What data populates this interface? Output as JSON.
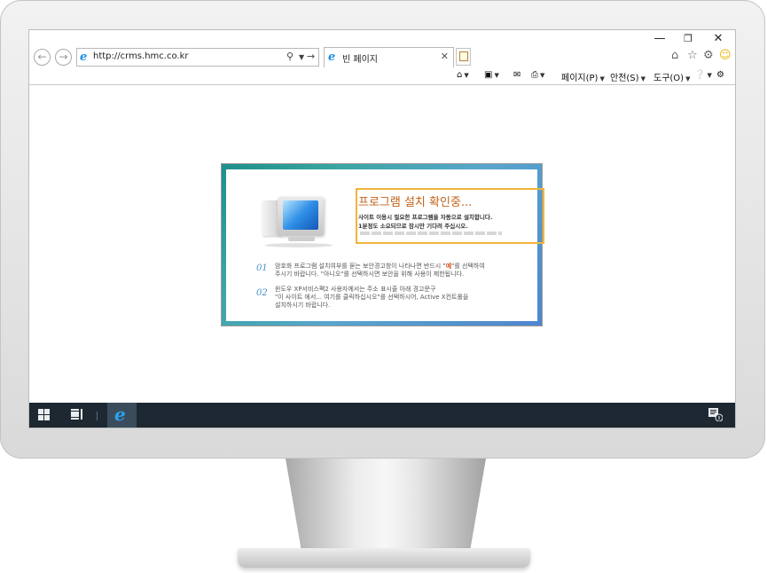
{
  "browser": {
    "address_url": "http://crms.hmc.co.kr",
    "tab_title": "빈 페이지",
    "command_bar": {
      "page_label": "페이지(P)",
      "safety_label": "안전(S)",
      "tools_label": "도구(O)"
    }
  },
  "dialog": {
    "title": "프로그램 설치 확인중...",
    "line1": "사이트 이용시 필요한 프로그램을 자동으로 설치합니다.",
    "line2": "1분정도 소요되므로 잠시만 기다려 주십시오.",
    "steps": [
      {
        "number": "01",
        "line1_a": "암호화 프로그램 설치여부를 묻는 보안경고창이 나타나면 반드시 \"",
        "line1_hl": "예",
        "line1_b": "\"를 선택하여",
        "line2": "주시기 바랍니다. \"아니오\"를 선택하시면 보안을 위해 사용이 제한됩니다."
      },
      {
        "number": "02",
        "line1": "윈도우 XP서비스팩2 사용자께서는 주소 표시줄 아래 경고문구",
        "line2": "\"이 사이트 에서... 여기를 클릭하십시오\"를 선택하시어, Active X컨트롤을",
        "line3": "설치하시기 바랍니다."
      }
    ]
  },
  "icons": {
    "back": "back-arrow-icon",
    "forward": "forward-arrow-icon",
    "search": "search-icon",
    "refresh": "go-arrow-icon",
    "home": "home-icon",
    "favorites": "star-icon",
    "settings": "gear-icon",
    "smiley": "smiley-icon"
  },
  "colors": {
    "taskbar": "#1d2832",
    "dialog_title": "#c0621a",
    "highlight_border": "#f0b43c",
    "step_number": "#4a8fc9"
  }
}
